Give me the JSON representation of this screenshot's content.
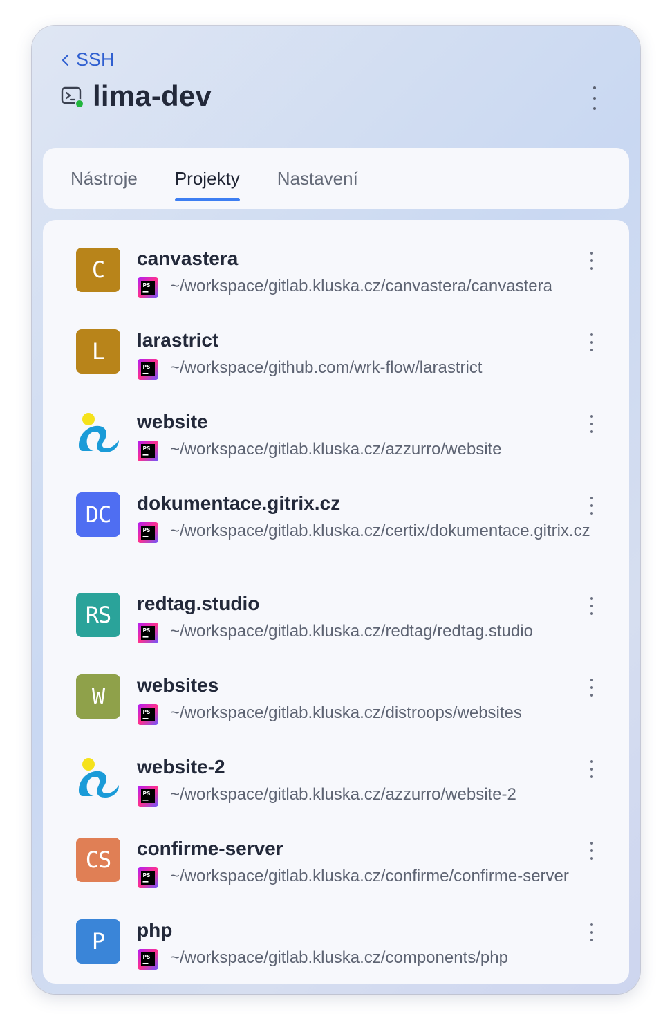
{
  "header": {
    "back_label": "SSH",
    "title": "lima-dev",
    "status_color": "#22b53d"
  },
  "tabs": [
    {
      "label": "Nástroje",
      "active": false
    },
    {
      "label": "Projekty",
      "active": true
    },
    {
      "label": "Nastavení",
      "active": false
    }
  ],
  "projects": [
    {
      "name": "canvastera",
      "avatar": "C",
      "avatar_color": "#b8841a",
      "ide_icon": "phpstorm-icon",
      "path": "~/workspace/gitlab.kluska.cz/canvastera/canvastera"
    },
    {
      "name": "larastrict",
      "avatar": "L",
      "avatar_color": "#b8841a",
      "ide_icon": "phpstorm-icon",
      "path": "~/workspace/github.com/wrk-flow/larastrict"
    },
    {
      "name": "website",
      "avatar": "",
      "avatar_icon": "azzurro-logo-icon",
      "ide_icon": "phpstorm-icon",
      "path": "~/workspace/gitlab.kluska.cz/azzurro/website"
    },
    {
      "name": "dokumentace.gitrix.cz",
      "avatar": "DC",
      "avatar_color": "#4f6ef2",
      "ide_icon": "phpstorm-icon",
      "path": "~/workspace/gitlab.kluska.cz/certix/dokumentace.gitrix.cz"
    },
    {
      "name": "redtag.studio",
      "avatar": "RS",
      "avatar_color": "#2aa39a",
      "ide_icon": "phpstorm-icon",
      "path": "~/workspace/gitlab.kluska.cz/redtag/redtag.studio"
    },
    {
      "name": "websites",
      "avatar": "W",
      "avatar_color": "#8fa14a",
      "ide_icon": "phpstorm-icon",
      "path": "~/workspace/gitlab.kluska.cz/distroops/websites"
    },
    {
      "name": "website-2",
      "avatar": "",
      "avatar_icon": "azzurro-logo-icon",
      "ide_icon": "phpstorm-icon",
      "path": "~/workspace/gitlab.kluska.cz/azzurro/website-2"
    },
    {
      "name": "confirme-server",
      "avatar": "CS",
      "avatar_color": "#e07f55",
      "ide_icon": "phpstorm-icon",
      "path": "~/workspace/gitlab.kluska.cz/confirme/confirme-server"
    },
    {
      "name": "php",
      "avatar": "P",
      "avatar_color": "#3a85d8",
      "ide_icon": "phpstorm-icon",
      "path": "~/workspace/gitlab.kluska.cz/components/php"
    }
  ]
}
